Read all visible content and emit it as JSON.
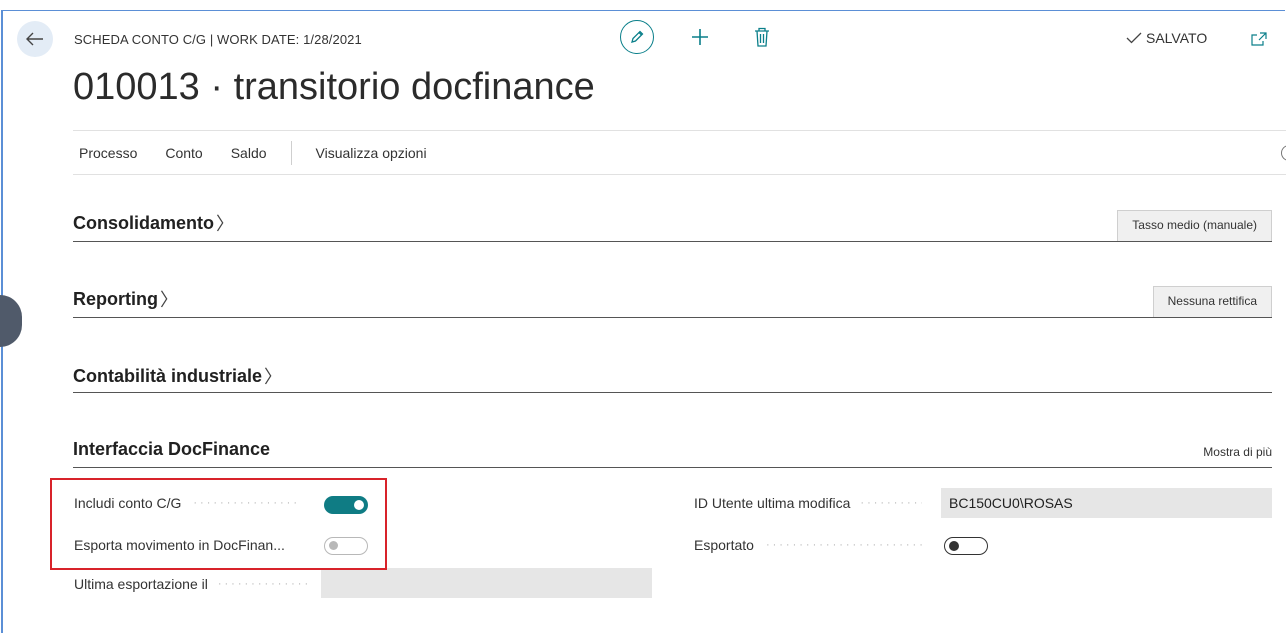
{
  "header": {
    "caption": "SCHEDA CONTO C/G | WORK DATE: 1/28/2021",
    "title": "010013 · transitorio docfinance",
    "status": "SALVATO"
  },
  "actions": {
    "items": [
      "Processo",
      "Conto",
      "Saldo"
    ],
    "options_label": "Visualizza opzioni"
  },
  "sections": {
    "consolidamento": {
      "title": "Consolidamento",
      "value": "Tasso medio (manuale)"
    },
    "reporting": {
      "title": "Reporting",
      "value": "Nessuna rettifica"
    },
    "contabilita": {
      "title": "Contabilità industriale"
    },
    "interfaccia": {
      "title": "Interfaccia DocFinance",
      "show_more": "Mostra di più"
    }
  },
  "fields": {
    "includi_label": "Includi conto C/G",
    "includi_value": true,
    "esporta_label": "Esporta movimento in DocFinan...",
    "esporta_value": false,
    "ultima_label": "Ultima esportazione il",
    "ultima_value": "",
    "utente_label": "ID Utente ultima modifica",
    "utente_value": "BC150CU0\\ROSAS",
    "esportato_label": "Esportato",
    "esportato_value": false
  },
  "icons": {
    "back": "arrow-left-icon",
    "edit": "pencil-icon",
    "new": "plus-icon",
    "delete": "trash-icon",
    "saved": "check-icon",
    "popout": "popout-icon"
  },
  "colors": {
    "accent": "#0f7c84",
    "highlight": "#d8232a",
    "frame": "#5b8fd6"
  }
}
